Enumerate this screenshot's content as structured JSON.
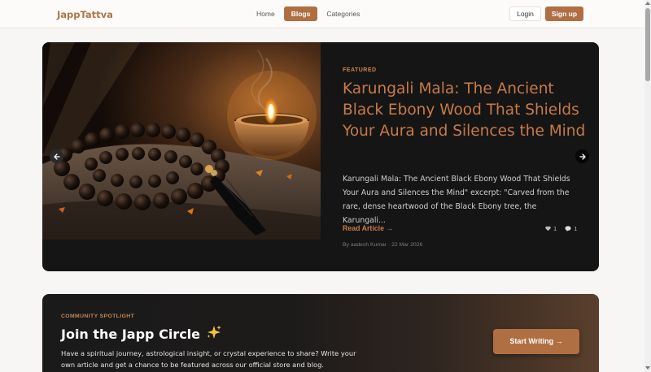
{
  "nav": {
    "logo": "JappTattva",
    "links": [
      {
        "label": "Home",
        "active": false
      },
      {
        "label": "Blogs",
        "active": true
      },
      {
        "label": "Categories",
        "active": false
      }
    ],
    "login_label": "Login",
    "signup_label": "Sign up"
  },
  "featured": {
    "label": "FEATURED",
    "title": "Karungali Mala: The Ancient Black Ebony Wood That Shields Your Aura and Silences the Mind",
    "excerpt": "Karungali Mala: The Ancient Black Ebony Wood That Shields Your Aura and Silences the Mind\" excerpt: \"Carved from the rare, dense heartwood of the Black Ebony tree, the Karungali...",
    "read_more": "Read Article →",
    "likes": "1",
    "comments": "1",
    "byline": "By aadesh Kumar · 22 Mar 2026",
    "image_icon": "mala-beads-and-diya-photo"
  },
  "community": {
    "label": "COMMUNITY SPOTLIGHT",
    "title": "Join the Japp Circle",
    "title_icon": "sparkles-icon",
    "text": "Have a spiritual journey, astrological insight, or crystal experience to share? Write your own article and get a chance to be featured across our official store and blog.",
    "cta": "Start Writing →"
  },
  "colors": {
    "accent": "#b06f43",
    "accent_text": "#c77a48",
    "card_bg": "#151515",
    "page_bg": "#f7f6f5"
  }
}
